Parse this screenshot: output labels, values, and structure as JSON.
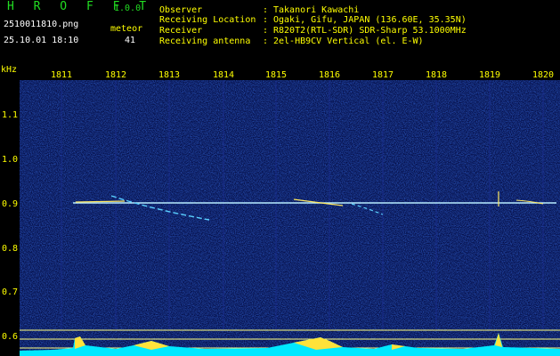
{
  "header": {
    "app_title": "H R O F F T",
    "app_version": "1.0.0",
    "file_name": "2510011810.png",
    "date_time": "25.10.01 18:10",
    "meteor_label": "meteor",
    "meteor_count": "41"
  },
  "info": {
    "observer_label": "Observer",
    "observer_value": "Takanori Kawachi",
    "location_label": "Receiving Location",
    "location_value": "Ogaki, Gifu, JAPAN (136.60E, 35.35N)",
    "receiver_label": "Receiver",
    "receiver_value": "R820T2(RTL-SDR) SDR-Sharp 53.1000MHz",
    "antenna_label": "Receiving antenna",
    "antenna_value": "2el-HB9CV Vertical (el. E-W)",
    "separator": ":"
  },
  "axes": {
    "y_unit": "kHz",
    "y_ticks": [
      "1.1",
      "1.0",
      "0.9",
      "0.8",
      "0.7",
      "0.6"
    ],
    "x_ticks": [
      "1811",
      "1812",
      "1813",
      "1814",
      "1815",
      "1816",
      "1817",
      "1818",
      "1819",
      "1820"
    ]
  },
  "colors": {
    "background": "#000000",
    "label": "#ffff00",
    "title": "#22dd22",
    "noise_base": "#0a1470",
    "signal": "#c8f0ff"
  }
}
